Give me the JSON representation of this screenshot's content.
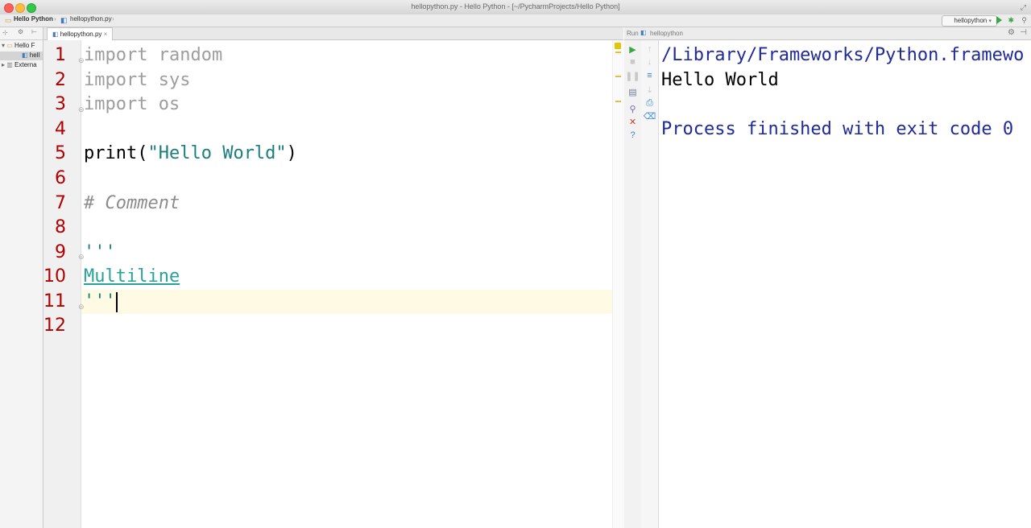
{
  "window": {
    "title": "hellopython.py - Hello Python - [~/PycharmProjects/Hello Python]"
  },
  "navbar": {
    "breadcrumb_project": "Hello Python",
    "breadcrumb_file": "hellopython.py",
    "run_config": "hellopython"
  },
  "project_tree": {
    "items": [
      "Hello F",
      "hell",
      "Externa"
    ]
  },
  "editor": {
    "tab_label": "hellopython.py",
    "line_numbers": [
      "1",
      "2",
      "3",
      "4",
      "5",
      "6",
      "7",
      "8",
      "9",
      "10",
      "11",
      "12"
    ],
    "lines": {
      "l1": "import random",
      "l2": "import sys",
      "l3": "import os",
      "l5_fn": "print(",
      "l5_str": "\"Hello World\"",
      "l5_close": ")",
      "l7": "# Comment",
      "l9": "'''",
      "l10": "Multiline",
      "l11": "'''"
    }
  },
  "run_panel": {
    "header_label": "Run",
    "config_label": "hellopython",
    "output": {
      "path": "/Library/Frameworks/Python.framewo",
      "stdout": "Hello World",
      "exit": "Process finished with exit code 0"
    }
  },
  "colors": {
    "line_number": "#b00000",
    "keyword": "#9d9d9d",
    "string": "#1b7f7f",
    "console_path": "#1f2a9b",
    "current_line": "#fffae3"
  }
}
